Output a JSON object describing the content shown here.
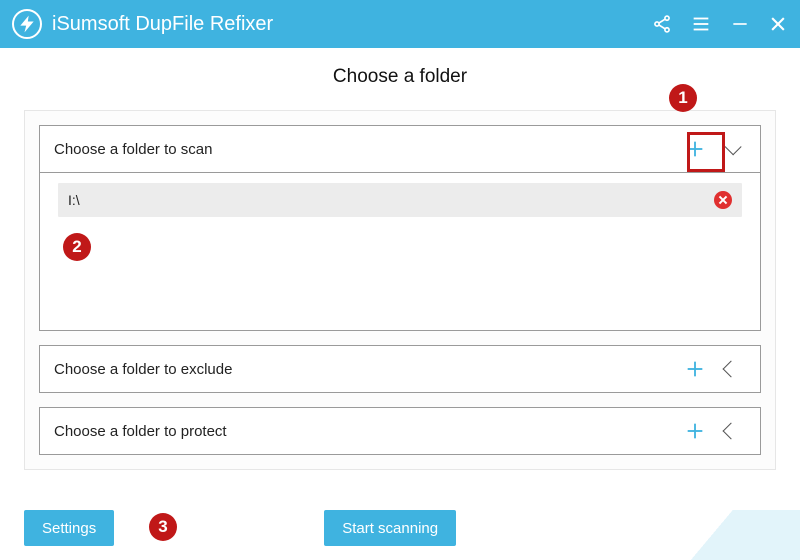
{
  "app": {
    "title": "iSumsoft DupFile Refixer"
  },
  "page": {
    "heading": "Choose a folder"
  },
  "sections": {
    "scan": {
      "label": "Choose a folder to scan",
      "expanded": true,
      "folders": [
        {
          "path": "I:\\"
        }
      ]
    },
    "exclude": {
      "label": "Choose a folder to exclude",
      "expanded": false
    },
    "protect": {
      "label": "Choose a folder to protect",
      "expanded": false
    }
  },
  "buttons": {
    "settings": "Settings",
    "start": "Start scanning"
  },
  "annotations": {
    "one": "1",
    "two": "2",
    "three": "3"
  }
}
